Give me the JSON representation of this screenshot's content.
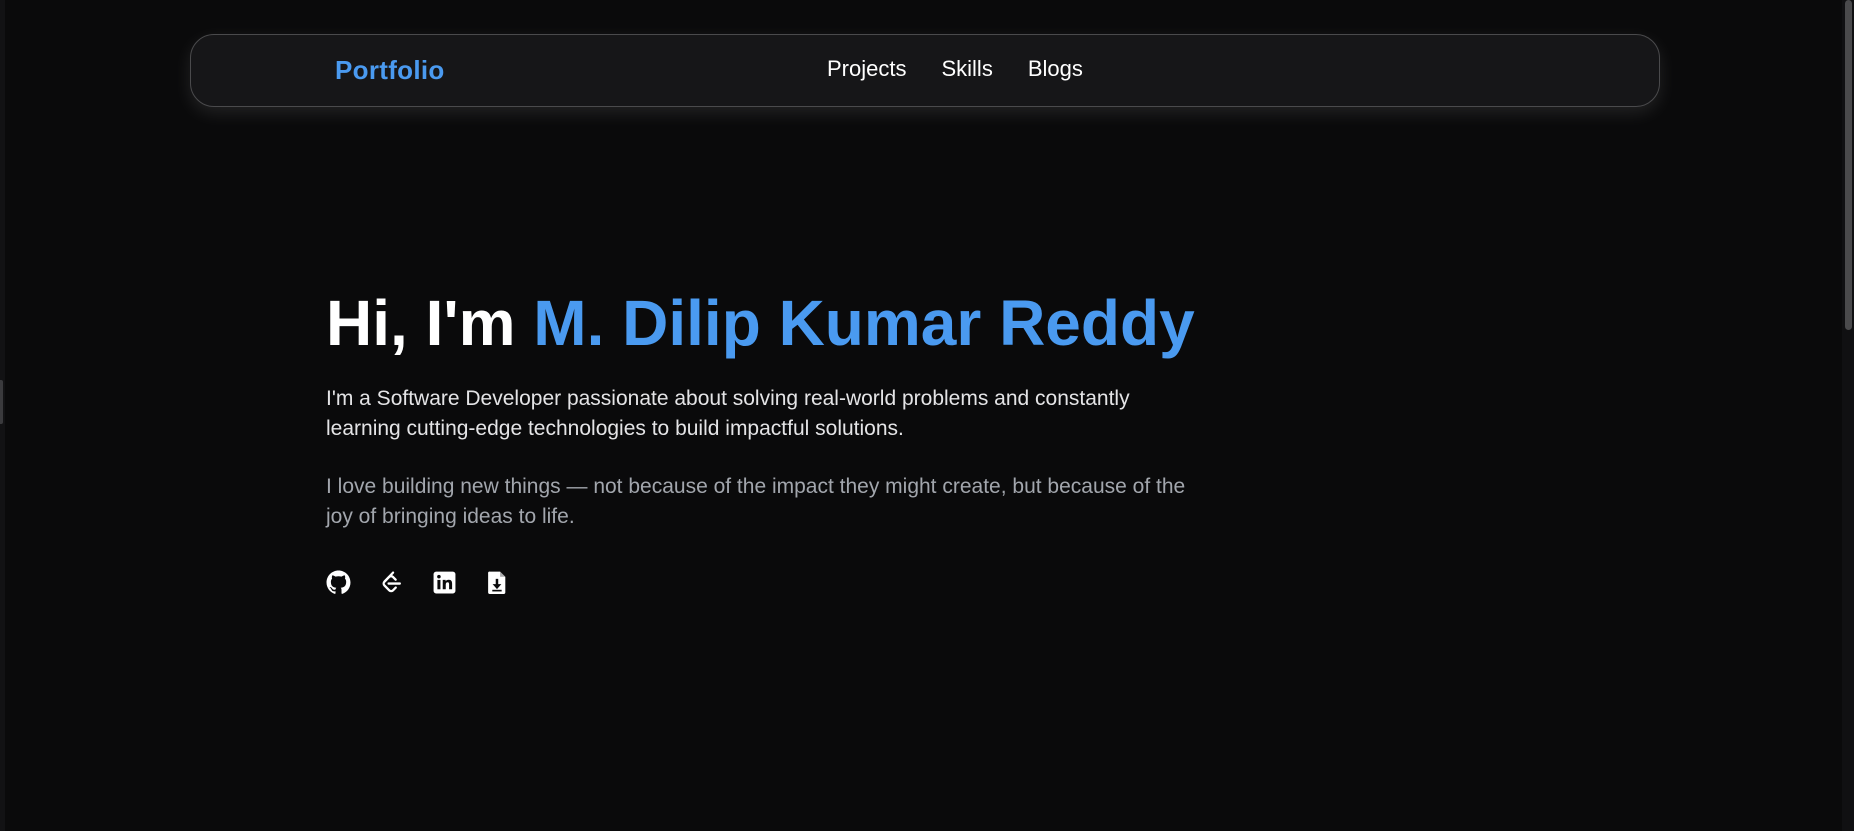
{
  "nav": {
    "brand": "Portfolio",
    "links": [
      {
        "label": "Projects"
      },
      {
        "label": "Skills"
      },
      {
        "label": "Blogs"
      }
    ]
  },
  "hero": {
    "greeting": "Hi, I'm ",
    "name": "M. Dilip Kumar Reddy",
    "description": "I'm a Software Developer passionate about solving real-world problems and constantly learning cutting-edge technologies to build impactful solutions.",
    "quote": "I love building new things — not because of the impact they might create, but because of the joy of bringing ideas to life."
  },
  "socials": [
    {
      "icon": "github-icon"
    },
    {
      "icon": "leetcode-icon"
    },
    {
      "icon": "linkedin-icon"
    },
    {
      "icon": "resume-download-icon"
    }
  ],
  "colors": {
    "background": "#0a0a0b",
    "accent": "#4a9af0",
    "text": "#ffffff",
    "muted": "#a2a6ad"
  }
}
